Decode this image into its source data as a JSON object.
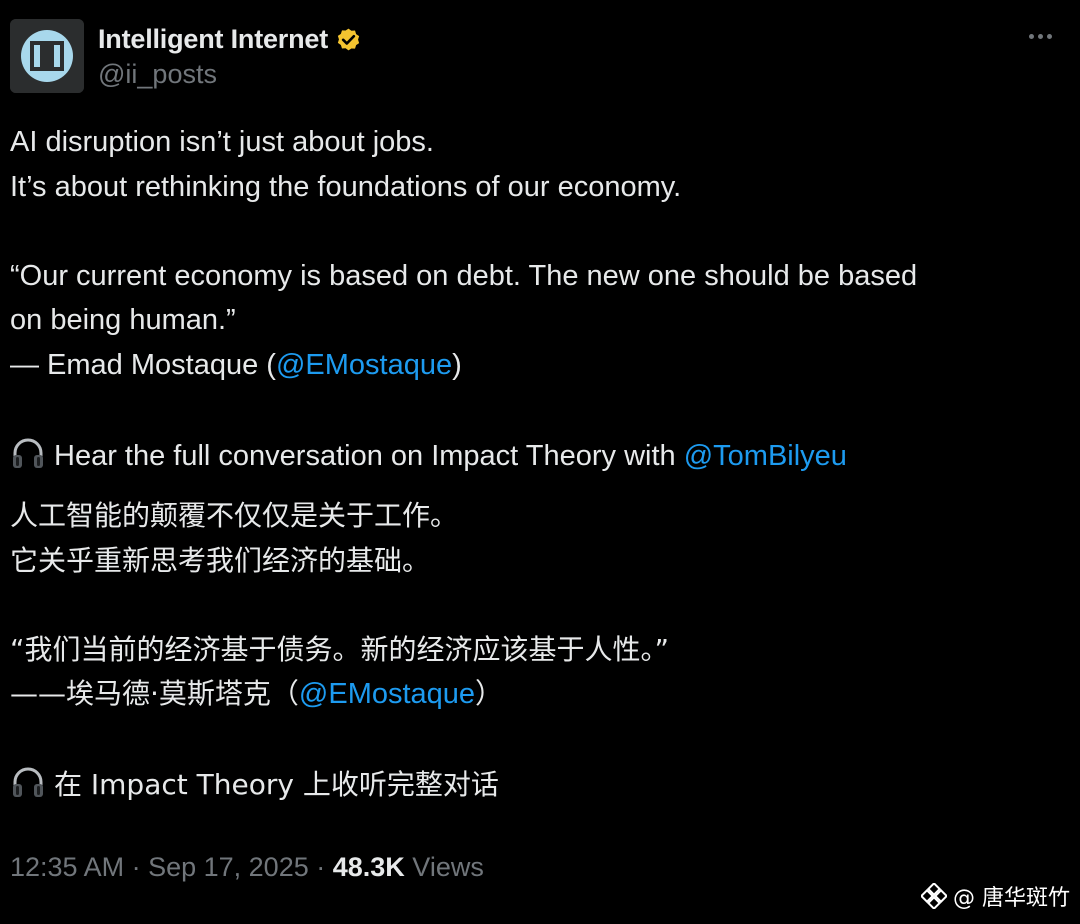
{
  "author": {
    "display_name": "Intelligent Internet",
    "handle": "@ii_posts",
    "verified_badge": "verified-badge-icon",
    "verified_color": "#f4c430"
  },
  "tweet": {
    "en_line1": "AI disruption isn’t just about jobs.",
    "en_line2": "It’s about rethinking the foundations of our economy.",
    "en_quote1": "“Our current economy is based on debt. The new one should be based",
    "en_quote2": "on being human.”",
    "en_attr_prefix": "— Emad Mostaque (",
    "en_attr_mention": "@EMostaque",
    "en_attr_suffix": ")",
    "en_listen_text": "Hear the full conversation on Impact Theory with ",
    "en_listen_mention": "@TomBilyeu",
    "cn_line1": "人工智能的颠覆不仅仅是关于工作。",
    "cn_line2": "它关乎重新思考我们经济的基础。",
    "cn_quote": "“我们当前的经济基于债务。新的经济应该基于人性。”",
    "cn_attr_prefix": "——埃马德·莫斯塔克（",
    "cn_attr_mention": "@EMostaque",
    "cn_attr_suffix": "）",
    "cn_listen_text": "在 Impact Theory 上收听完整对话",
    "listen_icon": "headphones-icon"
  },
  "meta": {
    "time": "12:35 AM",
    "separator": " · ",
    "date": "Sep 17, 2025",
    "views_count": "48.3K",
    "views_label": " Views"
  },
  "watermark": {
    "text": "@ 唐华斑竹",
    "logo": "binance-logo-icon"
  },
  "colors": {
    "background": "#000000",
    "text": "#e7e9ea",
    "secondary": "#71767b",
    "link": "#1d9bf0"
  }
}
